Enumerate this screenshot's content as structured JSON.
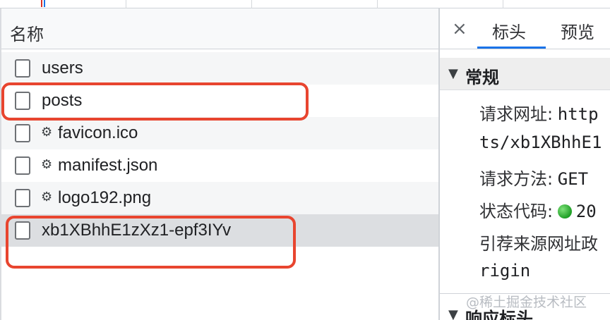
{
  "network_list": {
    "column_header": "名称",
    "rows": [
      {
        "label": "users",
        "has_icon": false
      },
      {
        "label": "posts",
        "has_icon": false
      },
      {
        "label": "favicon.ico",
        "has_icon": true
      },
      {
        "label": "manifest.json",
        "has_icon": true
      },
      {
        "label": "logo192.png",
        "has_icon": true
      },
      {
        "label": "xb1XBhhE1zXz1-epf3IYv",
        "has_icon": false
      }
    ],
    "row_icon_glyph": "⚙",
    "row_icon_name": "gear-icon"
  },
  "details": {
    "close_glyph": "×",
    "tabs": [
      {
        "label": "标头",
        "active": true
      },
      {
        "label": "预览",
        "active": false
      }
    ],
    "general_section": {
      "toggle_glyph": "▼",
      "title": "常规",
      "request_url_key": "请求网址:",
      "request_url_value_part1": "http",
      "request_url_value_part2": "ts/xb1XBhhE1",
      "request_method_key": "请求方法:",
      "request_method_value": "GET",
      "status_code_key": "状态代码:",
      "status_code_value": "20",
      "referrer_policy_key": "引荐来源网址政",
      "referrer_policy_value": "rigin"
    },
    "response_headers_section": {
      "toggle_glyph": "▼",
      "title": "响应标头"
    }
  },
  "watermark": "@稀土掘金技术社区",
  "colors": {
    "highlight_box": "#e8452f",
    "tab_underline": "#1a73e8",
    "status_dot": "#1e9e25",
    "selected_row": "#dcdee1"
  }
}
